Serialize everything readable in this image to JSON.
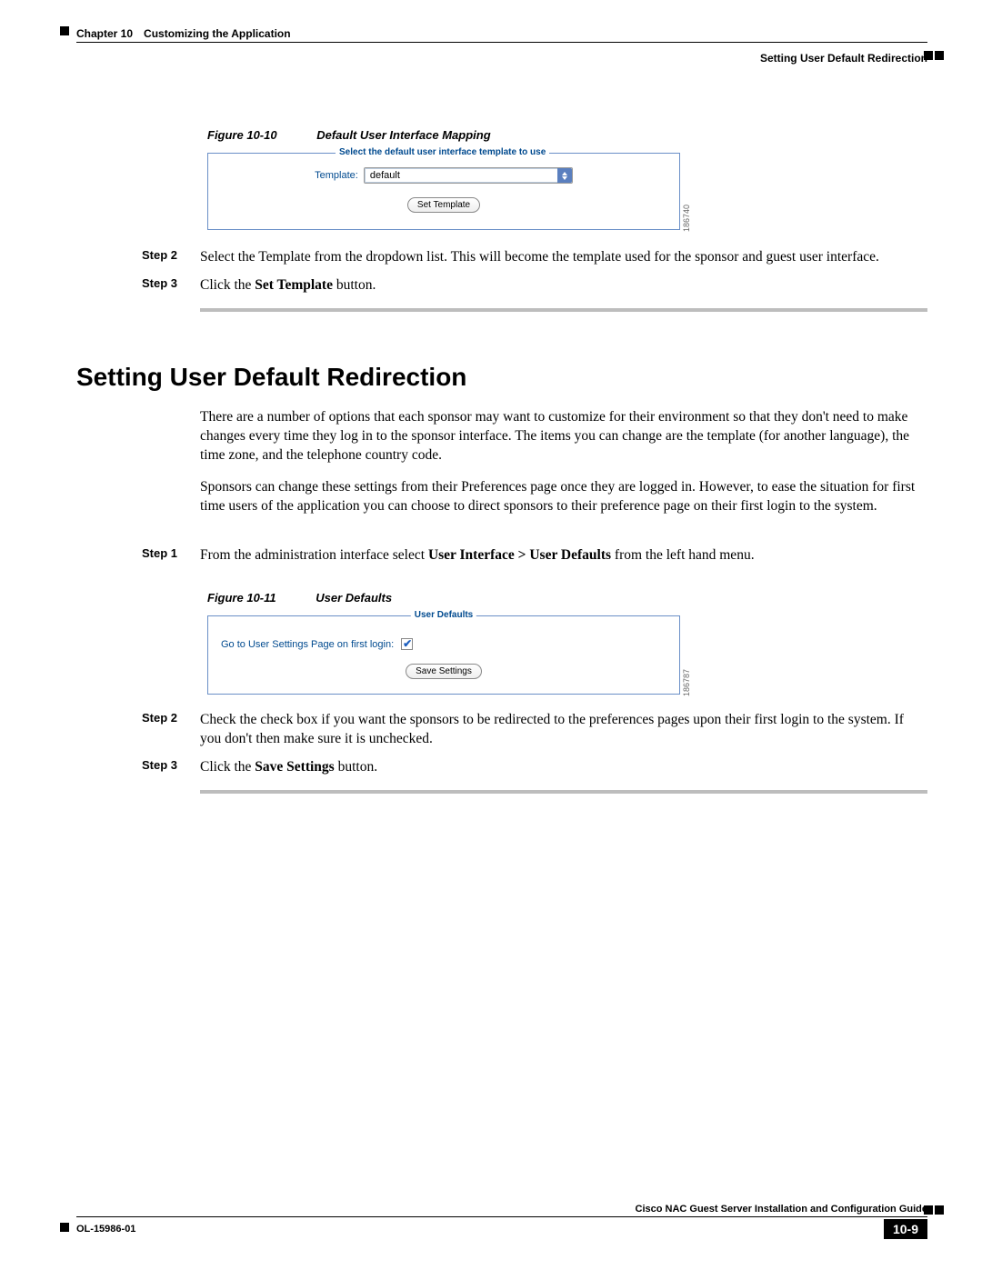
{
  "header": {
    "chapter_prefix": "Chapter 10",
    "chapter_title": "Customizing the Application",
    "section_crumb": "Setting User Default Redirection"
  },
  "figure10": {
    "num": "Figure 10-10",
    "title": "Default User Interface Mapping",
    "legend": "Select the default user interface template to use",
    "template_label": "Template:",
    "template_value": "default",
    "button_label": "Set Template",
    "side_id": "186740"
  },
  "steps_a": {
    "step2_label": "Step 2",
    "step2_text": "Select the Template from the dropdown list. This will become the template used for the sponsor and guest user interface.",
    "step3_label": "Step 3",
    "step3_prefix": "Click the ",
    "step3_bold": "Set Template",
    "step3_suffix": " button."
  },
  "section": {
    "title": "Setting User Default Redirection",
    "para1": "There are a number of options that each sponsor may want to customize for their environment so that they don't need to make changes every time they log in to the sponsor interface. The items you can change are the template (for another language), the time zone, and the telephone country code.",
    "para2": "Sponsors can change these settings from their Preferences page once they are logged in. However, to ease the situation for first time users of the application you can choose to direct sponsors to their preference page on their first login to the system."
  },
  "steps_b": {
    "step1_label": "Step 1",
    "step1_prefix": "From the administration interface select ",
    "step1_bold": "User Interface > User Defaults",
    "step1_suffix": " from the left hand menu."
  },
  "figure11": {
    "num": "Figure 10-11",
    "title": "User Defaults",
    "legend": "User Defaults",
    "check_label": "Go to User Settings Page on first login:",
    "button_label": "Save Settings",
    "side_id": "186787"
  },
  "steps_c": {
    "step2_label": "Step 2",
    "step2_text": "Check the check box if you want the sponsors to be redirected to the preferences pages upon their first login to the system. If you don't then make sure it is unchecked.",
    "step3_label": "Step 3",
    "step3_prefix": "Click the ",
    "step3_bold": "Save Settings",
    "step3_suffix": " button."
  },
  "footer": {
    "guide_title": "Cisco NAC Guest Server Installation and Configuration Guide",
    "doc_id": "OL-15986-01",
    "page_num": "10-9"
  }
}
